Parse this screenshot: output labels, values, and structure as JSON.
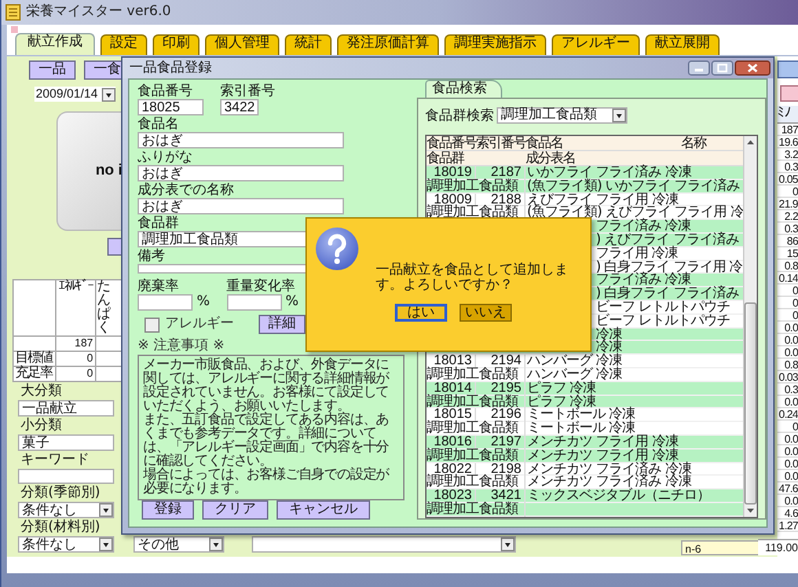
{
  "window": {
    "title": "栄養マイスター ver6.0"
  },
  "tabs": [
    {
      "label": "献立作成",
      "selected": true
    },
    {
      "label": "設定",
      "selected": false
    },
    {
      "label": "印刷",
      "selected": false
    },
    {
      "label": "個人管理",
      "selected": false
    },
    {
      "label": "統計",
      "selected": false
    },
    {
      "label": "発注原価計算",
      "selected": false
    },
    {
      "label": "調理実施指示",
      "selected": false
    },
    {
      "label": "アレルギー",
      "selected": false
    },
    {
      "label": "献立展開",
      "selected": false
    }
  ],
  "left_panel": {
    "buttons": [
      "一品",
      "一食"
    ],
    "date": "2009/01/14",
    "image_text": "no i",
    "nutrient_grid": {
      "columns": [
        "ｴﾈﾙｷﾞｰ",
        "たんぱく"
      ],
      "rows": [
        {
          "values": [
            "187"
          ]
        },
        {
          "label": "目標値",
          "values": [
            "0"
          ]
        },
        {
          "label": "充足率",
          "values": [
            "0"
          ]
        }
      ]
    },
    "fields": [
      {
        "kind": "text",
        "label": "大分類",
        "value": "一品献立"
      },
      {
        "kind": "text",
        "label": "小分類",
        "value": "菓子"
      },
      {
        "kind": "text",
        "label": "キーワード"
      },
      {
        "kind": "select",
        "label": "分類(季節別)",
        "value": "条件なし"
      },
      {
        "kind": "select",
        "label": "分類(材料別)",
        "value": "条件なし"
      }
    ]
  },
  "bottom_row": {
    "select": "その他",
    "total_label": "n-6"
  },
  "right_strip": {
    "header": "ﾐﾉ",
    "values": [
      "187",
      "19.6",
      "3.2",
      "0.3",
      "0.05",
      "0",
      "21.9",
      "2.2",
      "0.3",
      "86",
      "15",
      "0.8",
      "0.14",
      "0",
      "0",
      "0",
      "0.0",
      "0.0",
      "0.0",
      "0.8",
      "0.03",
      "0.3",
      "0.0",
      "0.24",
      "0",
      "0.0",
      "0.0",
      "0.0",
      "0.0",
      "47.6",
      "0.0",
      "4.6",
      "1.27"
    ],
    "total_value": "119.00"
  },
  "dialog": {
    "title": "一品食品登録",
    "form": {
      "food_number_label": "食品番号",
      "food_number": "18025",
      "index_number_label": "索引番号",
      "index_number": "3422",
      "fields": [
        {
          "label": "食品名",
          "value": "おはぎ"
        },
        {
          "label": "ふりがな",
          "value": "おはぎ"
        },
        {
          "label": "成分表での名称",
          "value": "おはぎ"
        },
        {
          "label": "食品群",
          "value": "調理加工食品類"
        }
      ],
      "remarks_label": "備考",
      "waste_label": "廃棄率",
      "waste_unit": "%",
      "weight_label": "重量変化率",
      "weight_unit": "%",
      "allergy": {
        "label": "アレルギー",
        "checked": false
      },
      "detail_button": "詳細",
      "notice_title": "※ 注意事項 ※",
      "notice": [
        "メーカー市販食品、および、外食データに関しては、アレルギーに関する詳細情報が設定されていません。お客様にて設定していただくよう、お願いいたします。",
        "また、五訂食品で設定してある内容は、あくまでも参考データです。詳細については、「アレルギー設定画面」で内容を十分に確認してください。",
        "場合によっては、お客様ご自身での設定が必要になります。"
      ],
      "buttons": [
        "登録",
        "クリア",
        "キャンセル"
      ]
    },
    "search": {
      "tab": "食品検索",
      "group_label": "食品群検索",
      "group_value": "調理加工食品類",
      "header_top": [
        "食品番号",
        "索引番号",
        "食品名",
        "名称"
      ],
      "header_bottom": [
        "食品群",
        "成分表名"
      ],
      "rows": [
        {
          "kind": "record",
          "cells": [
            "18019",
            "2187",
            "いかフライ フライ済み 冷凍"
          ]
        },
        {
          "kind": "group",
          "cells": [
            "調理加工食品類",
            "(魚フライ類) いかフライ フライ済み"
          ]
        },
        {
          "kind": "record",
          "cells": [
            "18009",
            "2188",
            "えびフライ フライ用 冷凍"
          ]
        },
        {
          "kind": "group",
          "cells": [
            "調理加工食品類",
            "(魚フライ類) えびフライ フライ用 冷"
          ]
        },
        {
          "kind": "covered",
          "cells": [
            "フライ済み 冷凍"
          ]
        },
        {
          "kind": "covered",
          "cells": [
            ") えびフライ フライ済み"
          ]
        },
        {
          "kind": "covered",
          "cells": [
            "フライ用 冷凍"
          ]
        },
        {
          "kind": "covered",
          "cells": [
            ") 白身フライ フライ用 冷"
          ]
        },
        {
          "kind": "covered",
          "cells": [
            "フライ済み 冷凍"
          ]
        },
        {
          "kind": "covered",
          "cells": [
            ") 白身フライ フライ済み"
          ]
        },
        {
          "kind": "covered",
          "cells": [
            "ビーフ レトルトパウチ"
          ]
        },
        {
          "kind": "covered",
          "cells": [
            "ビーフ レトルトパウチ"
          ]
        },
        {
          "kind": "covered",
          "cells": [
            "冷凍"
          ]
        },
        {
          "kind": "covered",
          "cells": [
            "冷凍"
          ]
        },
        {
          "kind": "record",
          "cells": [
            "18013",
            "2194",
            "ハンバーグ 冷凍"
          ]
        },
        {
          "kind": "group",
          "cells": [
            "調理加工食品類",
            "ハンバーグ 冷凍"
          ]
        },
        {
          "kind": "record",
          "cells": [
            "18014",
            "2195",
            "ピラフ 冷凍"
          ]
        },
        {
          "kind": "group",
          "cells": [
            "調理加工食品類",
            "ピラフ 冷凍"
          ]
        },
        {
          "kind": "record",
          "cells": [
            "18015",
            "2196",
            "ミートボール 冷凍"
          ]
        },
        {
          "kind": "group",
          "cells": [
            "調理加工食品類",
            "ミートボール 冷凍"
          ]
        },
        {
          "kind": "record",
          "cells": [
            "18016",
            "2197",
            "メンチカツ フライ用 冷凍"
          ]
        },
        {
          "kind": "group",
          "cells": [
            "調理加工食品類",
            "メンチカツ フライ用 冷凍"
          ]
        },
        {
          "kind": "record",
          "cells": [
            "18022",
            "2198",
            "メンチカツ フライ済み 冷凍"
          ]
        },
        {
          "kind": "group",
          "cells": [
            "調理加工食品類",
            "メンチカツ フライ済み 冷凍"
          ]
        },
        {
          "kind": "record",
          "cells": [
            "18023",
            "3421",
            "ミックスベジタブル（ニチロ）"
          ]
        },
        {
          "kind": "group",
          "cells": [
            "調理加工食品類"
          ]
        }
      ]
    }
  },
  "message_box": {
    "text": "一品献立を食品として追加します。よろしいですか？",
    "buttons": [
      {
        "label": "はい",
        "selected": true
      },
      {
        "label": "いいえ",
        "selected": false
      }
    ]
  }
}
